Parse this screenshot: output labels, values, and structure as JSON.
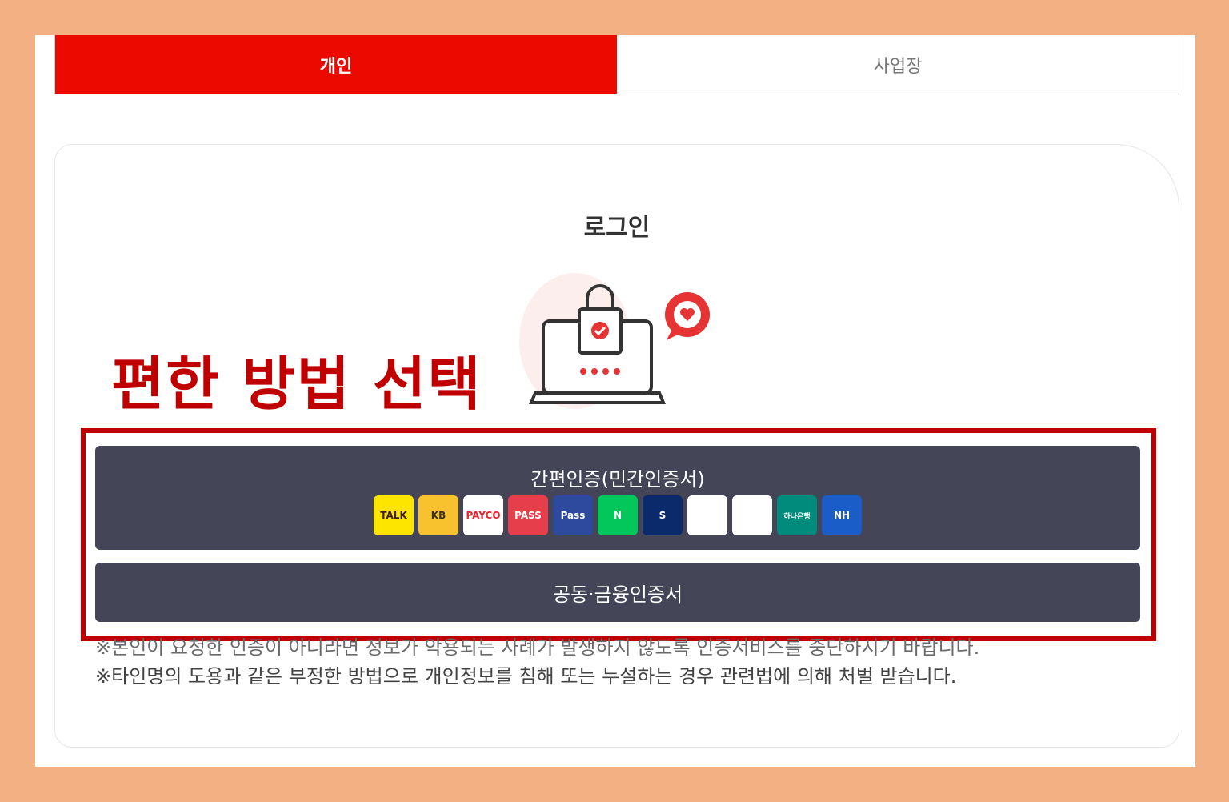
{
  "tabs": [
    {
      "label": "개인",
      "active": true
    },
    {
      "label": "사업장",
      "active": false
    }
  ],
  "login": {
    "title": "로그인"
  },
  "overlay": {
    "heading": "편한 방법 선택"
  },
  "buttons": {
    "simple_auth": "간편인증(민간인증서)",
    "joint_cert": "공동·금융인증서"
  },
  "auth_icons": [
    {
      "name": "kakaotalk-icon",
      "text": "TALK",
      "bg": "#fee500",
      "fg": "#3c1e1e"
    },
    {
      "name": "kb-icon",
      "text": "KB",
      "bg": "#f7c22d",
      "fg": "#3a3125"
    },
    {
      "name": "payco-icon",
      "text": "PAYCO",
      "bg": "#ffffff",
      "fg": "#e8242c"
    },
    {
      "name": "pass-icon",
      "text": "PASS",
      "bg": "#e63f4b",
      "fg": "#ffffff"
    },
    {
      "name": "samsung-pass-icon",
      "text": "Pass",
      "bg": "#2e4a9f",
      "fg": "#ffffff"
    },
    {
      "name": "naver-icon",
      "text": "N",
      "bg": "#03c75a",
      "fg": "#ffffff"
    },
    {
      "name": "shinhan-icon",
      "text": "S",
      "bg": "#0a2a6b",
      "fg": "#ffffff"
    },
    {
      "name": "toss-icon",
      "text": "",
      "bg": "#ffffff",
      "fg": "#1f6ef5"
    },
    {
      "name": "banksalad-icon",
      "text": "",
      "bg": "#ffffff",
      "fg": "#17c29a"
    },
    {
      "name": "hana-icon",
      "text": "하나은행",
      "bg": "#008b7d",
      "fg": "#ffffff"
    },
    {
      "name": "nh-icon",
      "text": "NH",
      "bg": "#1a5cc8",
      "fg": "#ffffff"
    }
  ],
  "notices": [
    "※본인이 요청한 인증이 아니라면 정보가 악용되는 사례가 발생하지 않도록 인증서비스를 중단하시기 바랍니다.",
    "※타인명의 도용과 같은 부정한 방법으로 개인정보를 침해 또는 누설하는 경우 관련법에 의해 처벌 받습니다."
  ],
  "colors": {
    "accent": "#ec0a00",
    "button_bg": "#444658",
    "highlight": "#c00000",
    "frame": "#f2b083"
  }
}
